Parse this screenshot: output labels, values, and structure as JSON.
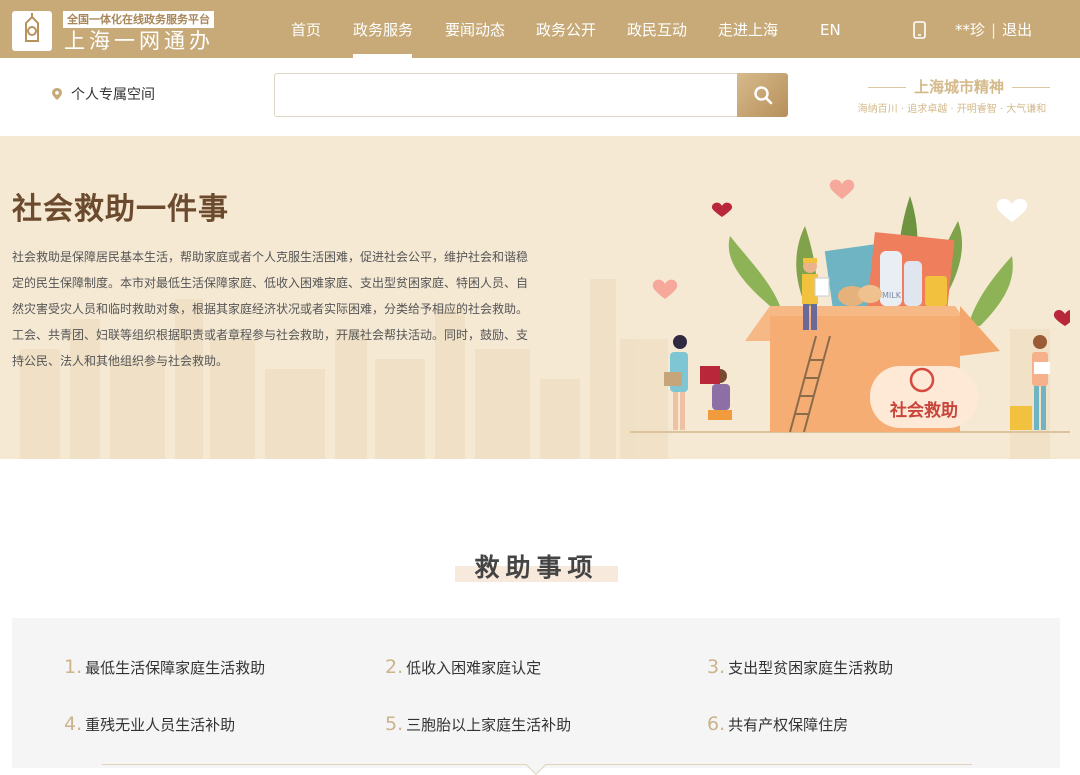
{
  "header": {
    "platform_tag": "全国一体化在线政务服务平台",
    "site_name": "上海一网通办",
    "nav": [
      "首页",
      "政务服务",
      "要闻动态",
      "政务公开",
      "政民互动",
      "走进上海",
      "EN"
    ],
    "active_nav": "政务服务",
    "user_name": "**珍",
    "separator": "|",
    "logout": "退出"
  },
  "search": {
    "personal_space": "个人专属空间",
    "placeholder": "",
    "spirit_title": "上海城市精神",
    "spirit_sub": "海纳百川 · 追求卓越 · 开明睿智 · 大气谦和"
  },
  "banner": {
    "title": "社会救助一件事",
    "description": "社会救助是保障居民基本生活，帮助家庭或者个人克服生活困难，促进社会公平，维护社会和谐稳定的民生保障制度。本市对最低生活保障家庭、低收入困难家庭、支出型贫困家庭、特困人员、自然灾害受灾人员和临时救助对象，根据其家庭经济状况或者实际困难，分类给予相应的社会救助。工会、共青团、妇联等组织根据职责或者章程参与社会救助，开展社会帮扶活动。同时，鼓励、支持公民、法人和其他组织参与社会救助。",
    "box_label": "社会救助",
    "bottle_label": "MILK"
  },
  "section": {
    "title": "救助事项"
  },
  "items": [
    {
      "num": "1.",
      "label": "最低生活保障家庭生活救助"
    },
    {
      "num": "2.",
      "label": "低收入困难家庭认定"
    },
    {
      "num": "3.",
      "label": "支出型贫困家庭生活救助"
    },
    {
      "num": "4.",
      "label": "重残无业人员生活补助"
    },
    {
      "num": "5.",
      "label": "三胞胎以上家庭生活补助"
    },
    {
      "num": "6.",
      "label": "共有产权保障住房"
    }
  ],
  "colors": {
    "brand": "#c7aa78",
    "banner_bg": "#f5e9d4",
    "title_brown": "#6b4a2e",
    "number_gold": "#cbb38a"
  }
}
